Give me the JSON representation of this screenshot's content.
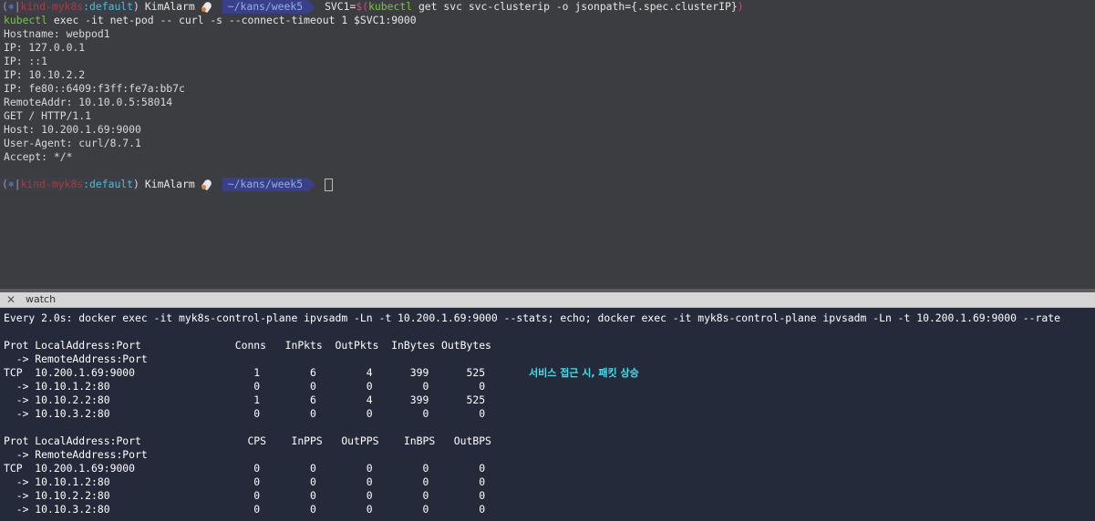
{
  "top_pane": {
    "prompt": {
      "k8s_open": "(",
      "k8s_icon": "⎈",
      "k8s_sep": "|",
      "k8s_context": "kind-myk8s",
      "k8s_colon": ":",
      "k8s_namespace": "default",
      "k8s_close": ")",
      "user": "KimAlarm",
      "path": "~/kans/week5"
    },
    "command1": {
      "part1": "SVC1=",
      "part2": "$(",
      "part3": "kubectl",
      "part4": " get svc svc-clusterip -o jsonpath={.spec.clusterIP}",
      "part5": ")"
    },
    "command2": {
      "part1": "kubectl",
      "part2": " exec -it net-pod -- curl -s --connect-timeout 1 $SVC1:9000"
    },
    "output": [
      "Hostname: webpod1",
      "IP: 127.0.0.1",
      "IP: ::1",
      "IP: 10.10.2.2",
      "IP: fe80::6409:f3ff:fe7a:bb7c",
      "RemoteAddr: 10.10.0.5:58014",
      "GET / HTTP/1.1",
      "Host: 10.200.1.69:9000",
      "User-Agent: curl/8.7.1",
      "Accept: */*"
    ]
  },
  "tab": {
    "close_glyph": "✕",
    "title": "watch"
  },
  "watch_pane": {
    "header": "Every 2.0s: docker exec -it myk8s-control-plane ipvsadm -Ln -t 10.200.1.69:9000 --stats; echo; docker exec -it myk8s-control-plane ipvsadm -Ln -t 10.200.1.69:9000 --rate",
    "stats_lines": [
      "Prot LocalAddress:Port               Conns   InPkts  OutPkts  InBytes OutBytes",
      "  -> RemoteAddress:Port",
      "TCP  10.200.1.69:9000                   1        6        4      399      525",
      "  -> 10.10.1.2:80                       0        0        0        0        0",
      "  -> 10.10.2.2:80                       1        6        4      399      525",
      "  -> 10.10.3.2:80                       0        0        0        0        0"
    ],
    "rate_lines": [
      "Prot LocalAddress:Port                 CPS    InPPS   OutPPS    InBPS   OutBPS",
      "  -> RemoteAddress:Port",
      "TCP  10.200.1.69:9000                   0        0        0        0        0",
      "  -> 10.10.1.2:80                       0        0        0        0        0",
      "  -> 10.10.2.2:80                       0        0        0        0        0",
      "  -> 10.10.3.2:80                       0        0        0        0        0"
    ],
    "annotation": "서비스 접근 시, 패킷 상승"
  },
  "colors": {
    "terminal_bg": "#3b3d41",
    "watch_bg": "#242a3a",
    "path_segment": "#3a3f8a",
    "kubectl_green": "#7cc24c",
    "annotation_cyan": "#3ee0f0"
  }
}
